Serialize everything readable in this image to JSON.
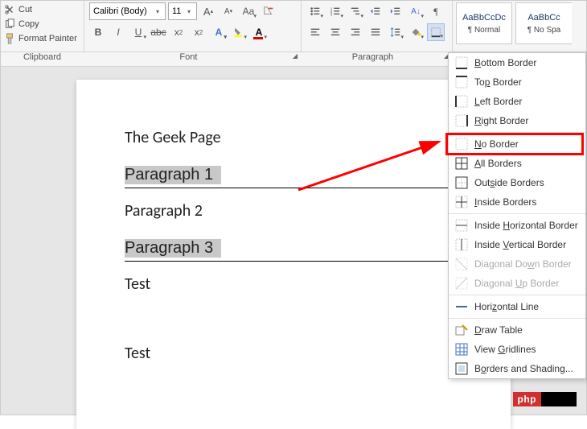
{
  "clipboard": {
    "cut": "Cut",
    "copy": "Copy",
    "format_painter": "Format Painter",
    "label": "Clipboard"
  },
  "font": {
    "name": "Calibri (Body)",
    "size": "11",
    "label": "Font"
  },
  "paragraph": {
    "label": "Paragraph"
  },
  "styles": {
    "normal_preview": "AaBbCcDc",
    "normal_name": "¶ Normal",
    "nospace_preview": "AaBbCc",
    "nospace_name": "¶ No Spa"
  },
  "border_menu": {
    "bottom": "ottom Border",
    "top": "op Border",
    "left": "eft Border",
    "right": "ight Border",
    "none": "o Border",
    "all": "ll Borders",
    "outside": "utside Borders",
    "inside": "nside Borders",
    "ih": "orizontal Border",
    "iv": "ertical Border",
    "dd": "own Border",
    "du": "p Border",
    "hz": "ine",
    "draw": "raw Table",
    "grid": "ridlines",
    "shading": "orders and Shading..."
  },
  "doc": {
    "title": "The Geek Page",
    "p1": "Paragraph 1",
    "p2": "Paragraph 2",
    "p3": "Paragraph 3",
    "t1": "Test",
    "t2": "Test"
  },
  "badge": {
    "php": "php"
  }
}
